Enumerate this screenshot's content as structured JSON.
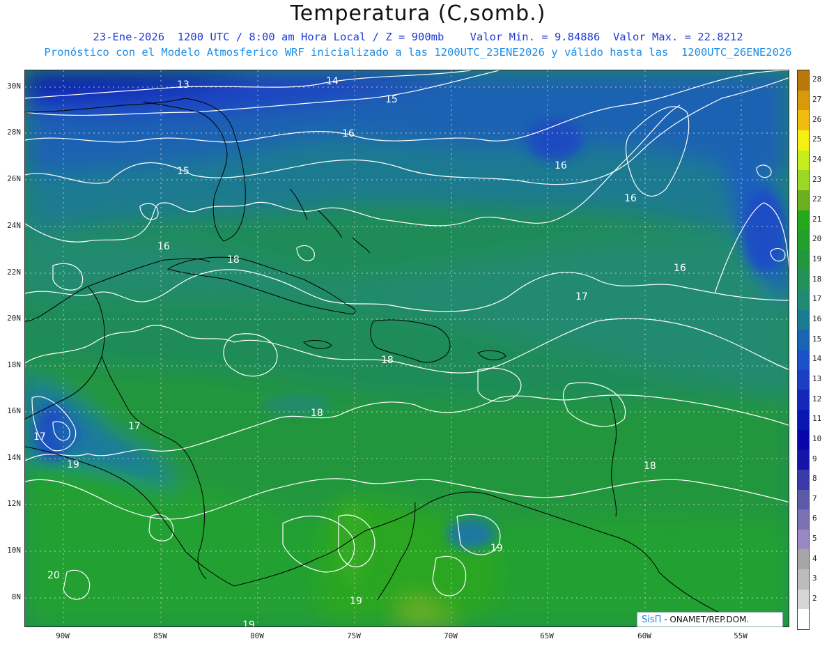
{
  "header": {
    "title": "Temperatura (C,somb.)",
    "subtitle_line1": "23-Ene-2026  1200 UTC / 8:00 am Hora Local / Z = 900mb    Valor Min. = 9.84886  Valor Max. = 22.8212",
    "subtitle_line2": "Pronóstico con el Modelo Atmosferico WRF inicializado a las 1200UTC_23ENE2026 y válido hasta las  1200UTC_26ENE2026"
  },
  "map": {
    "latitude_ticks": [
      "30N",
      "28N",
      "26N",
      "24N",
      "22N",
      "20N",
      "18N",
      "16N",
      "14N",
      "12N",
      "10N",
      "8N"
    ],
    "longitude_ticks": [
      "90W",
      "85W",
      "80W",
      "75W",
      "70W",
      "65W",
      "60W",
      "55W"
    ],
    "contour_labels": [
      {
        "text": "13"
      },
      {
        "text": "14"
      },
      {
        "text": "15"
      },
      {
        "text": "15"
      },
      {
        "text": "16"
      },
      {
        "text": "16"
      },
      {
        "text": "16"
      },
      {
        "text": "16"
      },
      {
        "text": "16"
      },
      {
        "text": "17"
      },
      {
        "text": "17"
      },
      {
        "text": "17"
      },
      {
        "text": "18"
      },
      {
        "text": "18"
      },
      {
        "text": "18"
      },
      {
        "text": "18"
      },
      {
        "text": "19"
      },
      {
        "text": "19"
      },
      {
        "text": "19"
      },
      {
        "text": "19"
      },
      {
        "text": "20"
      }
    ]
  },
  "colorbar": {
    "levels": [
      {
        "value": "28",
        "color": "#b8780a"
      },
      {
        "value": "27",
        "color": "#d89a0a"
      },
      {
        "value": "26",
        "color": "#f0bc10"
      },
      {
        "value": "25",
        "color": "#f5ef12"
      },
      {
        "value": "24",
        "color": "#c6ec1e"
      },
      {
        "value": "23",
        "color": "#9cd824"
      },
      {
        "value": "22",
        "color": "#6cb020"
      },
      {
        "value": "21",
        "color": "#24a81c"
      },
      {
        "value": "20",
        "color": "#22a02c"
      },
      {
        "value": "19",
        "color": "#22983e"
      },
      {
        "value": "18",
        "color": "#24905a"
      },
      {
        "value": "17",
        "color": "#208a72"
      },
      {
        "value": "16",
        "color": "#1a7a92"
      },
      {
        "value": "15",
        "color": "#1a64b2"
      },
      {
        "value": "14",
        "color": "#1c52c8"
      },
      {
        "value": "13",
        "color": "#1c3ec2"
      },
      {
        "value": "12",
        "color": "#1428b8"
      },
      {
        "value": "11",
        "color": "#0a16b0"
      },
      {
        "value": "10",
        "color": "#0606aa"
      },
      {
        "value": "9",
        "color": "#1414a8"
      },
      {
        "value": "8",
        "color": "#3a3aa8"
      },
      {
        "value": "7",
        "color": "#5a5aa8"
      },
      {
        "value": "6",
        "color": "#7a70b4"
      },
      {
        "value": "5",
        "color": "#9a88c2"
      },
      {
        "value": "4",
        "color": "#a6a6a6"
      },
      {
        "value": "3",
        "color": "#bcbcbc"
      },
      {
        "value": "2",
        "color": "#d6d6d6"
      },
      {
        "value": "",
        "color": "#ffffff"
      }
    ]
  },
  "credit": {
    "brand": "SisΠ",
    "text": " - ONAMET/REP.DOM."
  },
  "colors": {
    "title_text": "#111111",
    "subtitle_blue": "#1f3bd6",
    "subtitle_light_blue": "#1a8de8",
    "contour_line": "#ffffff",
    "coast_line": "#000000"
  }
}
